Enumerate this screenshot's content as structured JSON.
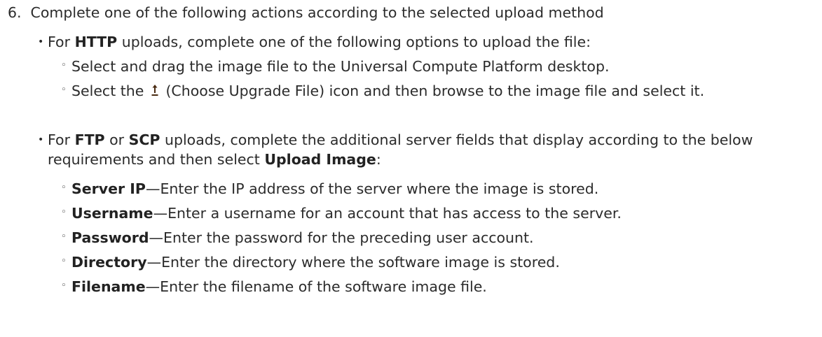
{
  "step": {
    "number": "6.",
    "text": "Complete one of the following actions according to the selected upload method"
  },
  "http": {
    "prefix": "For ",
    "bold": "HTTP",
    "suffix": " uploads, complete one of the following options to upload the file:",
    "options": {
      "drag": "Select and drag the image file to the Universal Compute Platform desktop.",
      "choose_before": "Select the ",
      "choose_after": " (Choose Upgrade File) icon and then browse to the image file and select it.",
      "choose_icon": "upload-arrow-icon"
    }
  },
  "ftp": {
    "prefix": "For ",
    "bold1": "FTP",
    "mid": " or ",
    "bold2": "SCP",
    "text": " uploads, complete the additional server fields that display according to the below requirements and then select ",
    "bold3": "Upload Image",
    "end": ":",
    "fields": [
      {
        "name": "Server IP",
        "desc": "—Enter the IP address of the server where the image is stored."
      },
      {
        "name": "Username",
        "desc": "—Enter a username for an account that has access to the server."
      },
      {
        "name": "Password",
        "desc": "—Enter the password for the preceding user account."
      },
      {
        "name": "Directory",
        "desc": "—Enter the directory where the software image is stored."
      },
      {
        "name": "Filename",
        "desc": "—Enter the filename of the software image file."
      }
    ]
  },
  "bullet_marks": {
    "level1": "•",
    "level2": "◦"
  },
  "colors": {
    "text": "#2b2b2b",
    "icon": "#4a2b12"
  }
}
